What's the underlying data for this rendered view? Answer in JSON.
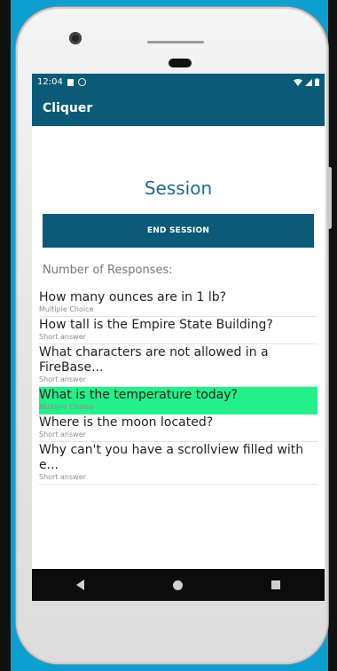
{
  "status_bar": {
    "time": "12:04",
    "icons": [
      "sim-icon",
      "data-saver-icon",
      "wifi-icon",
      "signal-icon",
      "battery-icon"
    ]
  },
  "app_bar": {
    "title": "Cliquer"
  },
  "main": {
    "title": "Session",
    "end_button_label": "END SESSION",
    "responses_label": "Number of Responses:",
    "questions": [
      {
        "text": "How many ounces are in 1 lb?",
        "type": "Multiple Choice",
        "highlighted": false
      },
      {
        "text": "How tall is the Empire State Building?",
        "type": "Short answer",
        "highlighted": false
      },
      {
        "text": "What characters are not allowed in a FireBase...",
        "type": "Short answer",
        "highlighted": false
      },
      {
        "text": "What is the temperature today?",
        "type": "Multiple Choice",
        "highlighted": true
      },
      {
        "text": "Where is the moon located?",
        "type": "Short answer",
        "highlighted": false
      },
      {
        "text": "Why can't you have a scrollview filled with e...",
        "type": "Short answer",
        "highlighted": false
      }
    ]
  },
  "nav_bar": {
    "icons": [
      "back-icon",
      "home-icon",
      "recents-icon"
    ]
  },
  "colors": {
    "background": "#0f9ed0",
    "app_bar": "#0b5a78",
    "title": "#1d6a8f",
    "highlight": "#24f08a"
  }
}
